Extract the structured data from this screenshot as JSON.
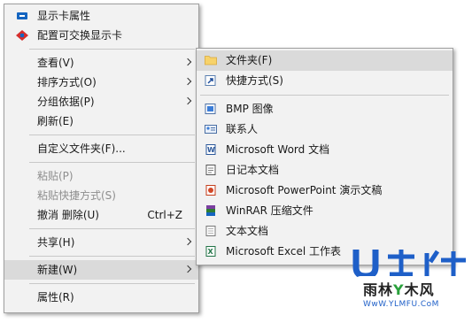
{
  "main_menu": {
    "display_settings": "显示卡属性",
    "gpu_config": "配置可交换显示卡",
    "view": "查看(V)",
    "sort_by": "排序方式(O)",
    "group_by": "分组依据(P)",
    "refresh": "刷新(E)",
    "customize_folder": "自定义文件夹(F)...",
    "paste": "粘贴(P)",
    "paste_shortcut": "粘贴快捷方式(S)",
    "undo_delete": "撤消 删除(U)",
    "undo_shortcut": "Ctrl+Z",
    "share": "共享(H)",
    "new": "新建(W)",
    "properties": "属性(R)"
  },
  "sub_menu": {
    "folder": "文件夹(F)",
    "shortcut": "快捷方式(S)",
    "bmp": "BMP 图像",
    "contact": "联系人",
    "word": "Microsoft Word 文档",
    "journal": "日记本文档",
    "powerpoint": "Microsoft PowerPoint 演示文稿",
    "winrar": "WinRAR 压缩文件",
    "text": "文本文档",
    "excel": "Microsoft Excel 工作表"
  },
  "watermark": {
    "site_part1": "雨林",
    "site_part2": "木风",
    "url": "WwW.YLMFU.CoM"
  },
  "colors": {
    "menu_bg": "#f2f2f2",
    "hover_bg": "#dadada",
    "watermark_blue": "#1e5fc8",
    "watermark_green": "#2aa13c"
  }
}
